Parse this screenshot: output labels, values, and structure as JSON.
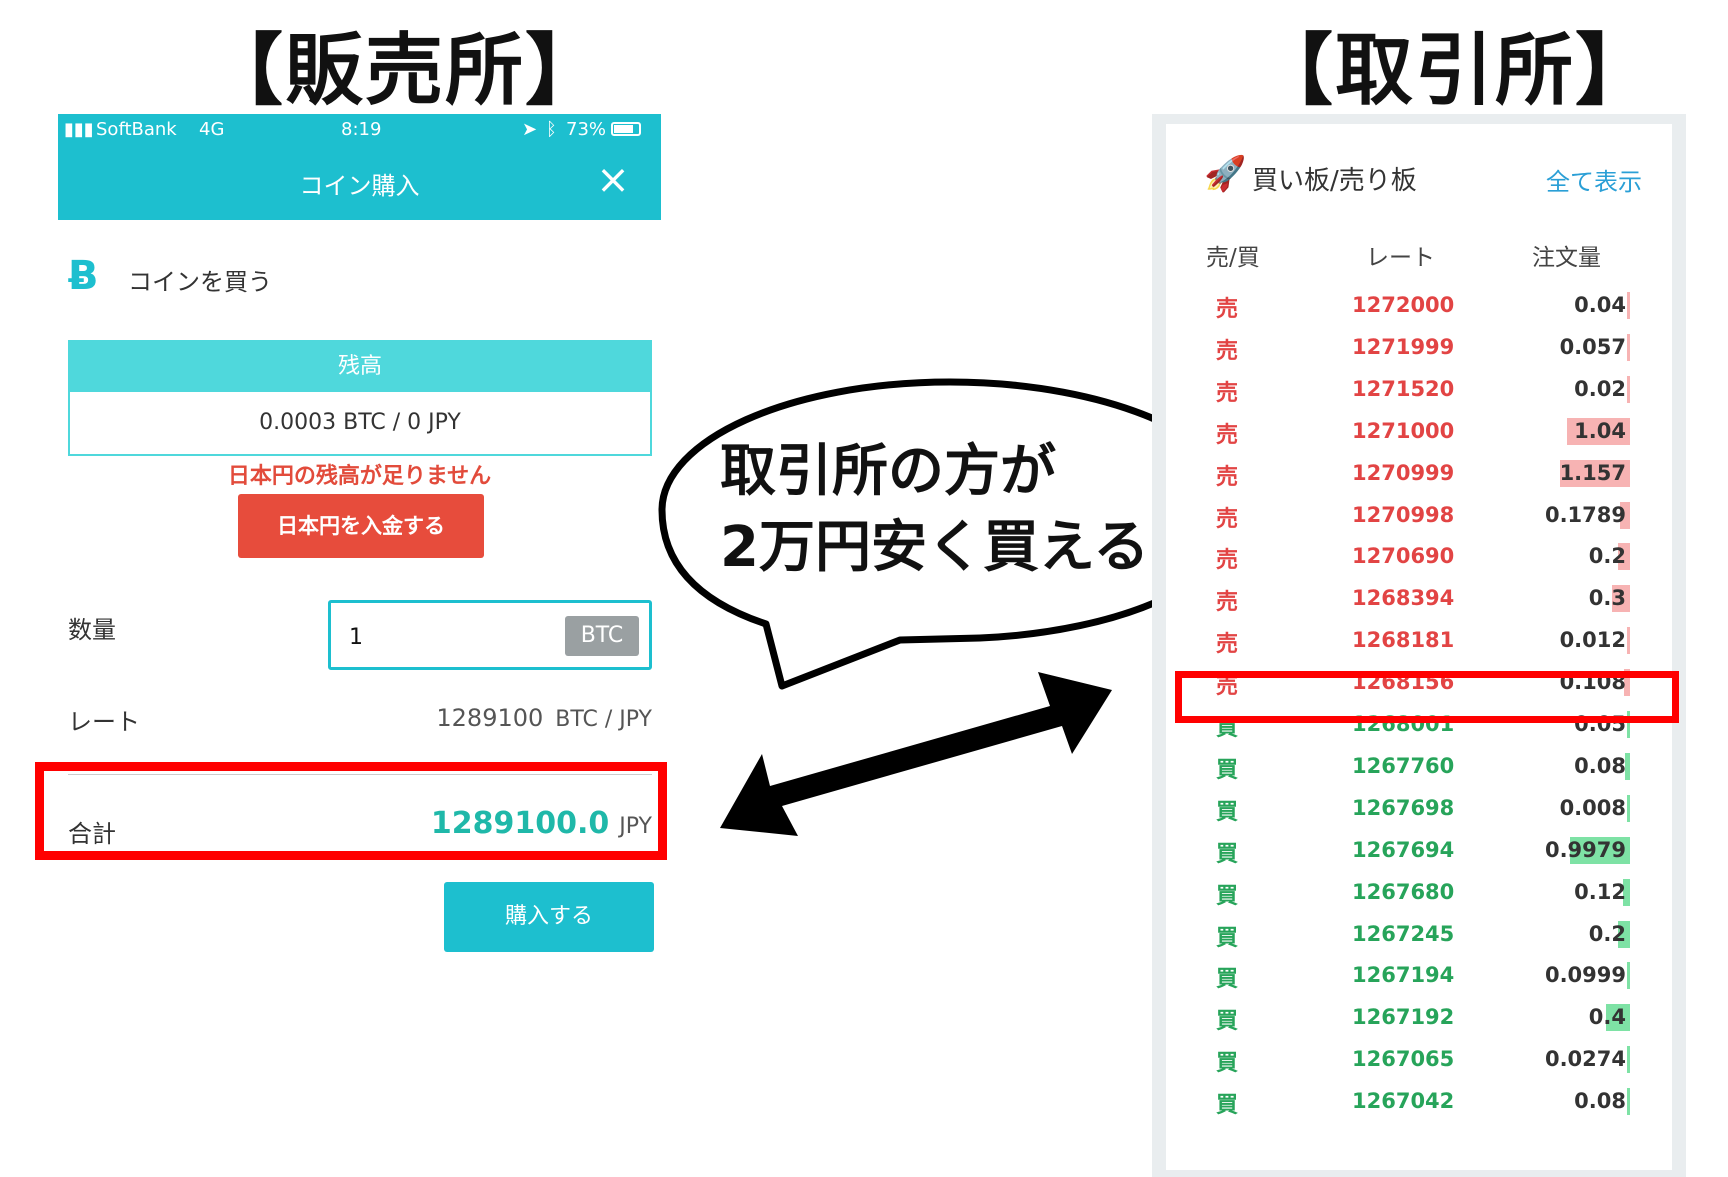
{
  "titles": {
    "left": "【販売所】",
    "right": "【取引所】"
  },
  "phone": {
    "status_bar": {
      "carrier": "SoftBank",
      "network": "4G",
      "time": "8:19",
      "battery": "73%"
    },
    "nav_title": "コイン購入",
    "close_icon": "×",
    "buy_heading": "コインを買う",
    "btc_icon": "Ƀ",
    "balance": {
      "header": "残高",
      "value": "0.0003 BTC / 0 JPY"
    },
    "balance_warning": "日本円の残高が足りません",
    "deposit_button": "日本円を入金する",
    "quantity": {
      "label": "数量",
      "value": "1",
      "unit": "BTC"
    },
    "rate": {
      "label": "レート",
      "value": "1289100",
      "unit": "BTC / JPY"
    },
    "total": {
      "label": "合計",
      "value": "1289100.0",
      "unit": "JPY"
    },
    "purchase_button": "購入する"
  },
  "bubble": {
    "line1": "取引所の方が",
    "line2": "2万円安く買える"
  },
  "orderbook": {
    "title": "買い板/売り板",
    "show_all": "全て表示",
    "headers": {
      "side": "売/買",
      "rate": "レート",
      "amount": "注文量"
    },
    "colors": {
      "sell": "#e24444",
      "buy": "#27a45a",
      "sell_bar": "#f7b3b3",
      "buy_bar": "#7ee2a5"
    },
    "rows": [
      {
        "side": "売",
        "type": "sell",
        "rate": "1272000",
        "amount": "0.04",
        "bar": 0.02
      },
      {
        "side": "売",
        "type": "sell",
        "rate": "1271999",
        "amount": "0.057",
        "bar": 0.02
      },
      {
        "side": "売",
        "type": "sell",
        "rate": "1271520",
        "amount": "0.02",
        "bar": 0.01
      },
      {
        "side": "売",
        "type": "sell",
        "rate": "1271000",
        "amount": "1.04",
        "bar": 0.9
      },
      {
        "side": "売",
        "type": "sell",
        "rate": "1270999",
        "amount": "1.157",
        "bar": 1.0
      },
      {
        "side": "売",
        "type": "sell",
        "rate": "1270998",
        "amount": "0.1789",
        "bar": 0.15
      },
      {
        "side": "売",
        "type": "sell",
        "rate": "1270690",
        "amount": "0.2",
        "bar": 0.17
      },
      {
        "side": "売",
        "type": "sell",
        "rate": "1268394",
        "amount": "0.3",
        "bar": 0.26
      },
      {
        "side": "売",
        "type": "sell",
        "rate": "1268181",
        "amount": "0.012",
        "bar": 0.01
      },
      {
        "side": "売",
        "type": "sell",
        "rate": "1268156",
        "amount": "0.108",
        "bar": 0.09
      },
      {
        "side": "買",
        "type": "buy",
        "rate": "1268001",
        "amount": "0.05",
        "bar": 0.04
      },
      {
        "side": "買",
        "type": "buy",
        "rate": "1267760",
        "amount": "0.08",
        "bar": 0.07
      },
      {
        "side": "買",
        "type": "buy",
        "rate": "1267698",
        "amount": "0.008",
        "bar": 0.0
      },
      {
        "side": "買",
        "type": "buy",
        "rate": "1267694",
        "amount": "0.9979",
        "bar": 0.86
      },
      {
        "side": "買",
        "type": "buy",
        "rate": "1267680",
        "amount": "0.12",
        "bar": 0.1
      },
      {
        "side": "買",
        "type": "buy",
        "rate": "1267245",
        "amount": "0.2",
        "bar": 0.17
      },
      {
        "side": "買",
        "type": "buy",
        "rate": "1267194",
        "amount": "0.0999",
        "bar": 0.05
      },
      {
        "side": "買",
        "type": "buy",
        "rate": "1267192",
        "amount": "0.4",
        "bar": 0.35
      },
      {
        "side": "買",
        "type": "buy",
        "rate": "1267065",
        "amount": "0.0274",
        "bar": 0.02
      },
      {
        "side": "買",
        "type": "buy",
        "rate": "1267042",
        "amount": "0.08",
        "bar": 0.04
      }
    ]
  }
}
